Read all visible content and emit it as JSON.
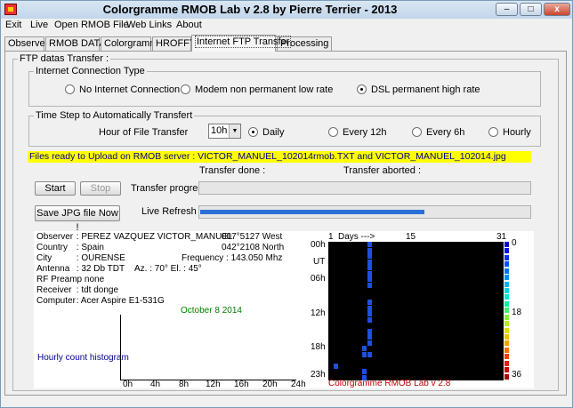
{
  "window": {
    "title": "Colorgramme RMOB Lab v 2.8  by Pierre Terrier  -  2013",
    "min_glyph": "–",
    "max_glyph": "□",
    "close_glyph": "x"
  },
  "menu": [
    "Exit",
    "Live",
    "Open RMOB File",
    "Web Links",
    "About"
  ],
  "tabs": [
    "Observer",
    "RMOB DATA",
    "Colorgramme",
    "HROFFT",
    "Internet FTP Transfer",
    "Processing"
  ],
  "active_tab": "Internet FTP Transfer",
  "ftp_group_label": "FTP datas Transfer :",
  "connection": {
    "label": "Internet Connection Type",
    "options": [
      "No Internet Connection",
      "Modem non permanent low rate",
      "DSL permanent high rate"
    ],
    "selected": "DSL permanent high rate"
  },
  "timestep": {
    "label": "Time Step to Automatically Transfert",
    "hour_label": "Hour of File Transfer",
    "hour_value": "10h",
    "options": [
      "Daily",
      "Every 12h",
      "Every 6h",
      "Hourly"
    ],
    "selected": "Daily"
  },
  "ready_text": "Files ready to Upload on RMOB server : VICTOR_MANUEL_102014rmob.TXT and VICTOR_MANUEL_102014.jpg",
  "transfer_done_label": "Transfer done :",
  "transfer_aborted_label": "Transfer aborted :",
  "start_label": "Start",
  "stop_label": "Stop",
  "transfer_progress_label": "Transfer progress",
  "transfer_progress": 0,
  "save_label": "Save  JPG  file Now !",
  "live_refresh_label": "Live Refresh",
  "live_refresh_progress": 0.68,
  "observer": {
    "observer": "PEREZ VAZQUEZ VICTOR_MANUEL",
    "longitude": "007°5127 West",
    "latitude": "042°2108 North",
    "country": "Spain",
    "city": "OURENSE",
    "frequency": "Frequency : 143.050 Mhz",
    "antenna": "32 Db TDT",
    "az_el": "Az. : 70°  El. : 45°",
    "rf_preamp": "none",
    "receiver": "tdt donge",
    "computer": "Acer Aspire E1-531G",
    "labels": {
      "observer": "Observer",
      "country": "Country",
      "city": "City",
      "antenna": "Antenna",
      "rf_preamp": "RF Preamp",
      "receiver": "Receiver",
      "computer": "Computer"
    }
  },
  "histogram": {
    "date": "October 8 2014",
    "label": "Hourly count histogram",
    "x_ticks": [
      "0h",
      "4h",
      "8h",
      "12h",
      "16h",
      "20h",
      "24h"
    ]
  },
  "colorgramme": {
    "x_start": "1",
    "days_label": "Days --->",
    "x_mid": "15",
    "x_end": "31",
    "y_labels": [
      "00h",
      "UT",
      "06h",
      "12h",
      "18h",
      "23h"
    ],
    "scale_labels": [
      "0",
      "18",
      "36"
    ],
    "footer": "Colorgramme RMOB Lab v 2.8",
    "cells": [
      {
        "day": 7,
        "hour": 0,
        "color": "#1f4fe0"
      },
      {
        "day": 7,
        "hour": 1,
        "color": "#1f4fe0"
      },
      {
        "day": 7,
        "hour": 2,
        "color": "#1f4fe0"
      },
      {
        "day": 7,
        "hour": 3,
        "color": "#1f4fe0"
      },
      {
        "day": 7,
        "hour": 4,
        "color": "#1f4fe0"
      },
      {
        "day": 7,
        "hour": 5,
        "color": "#1f4fe0"
      },
      {
        "day": 7,
        "hour": 6,
        "color": "#1f4fe0"
      },
      {
        "day": 7,
        "hour": 7,
        "color": "#1f4fe0"
      },
      {
        "day": 7,
        "hour": 10,
        "color": "#1f4fe0"
      },
      {
        "day": 7,
        "hour": 11,
        "color": "#1f4fe0"
      },
      {
        "day": 7,
        "hour": 12,
        "color": "#1f4fe0"
      },
      {
        "day": 7,
        "hour": 13,
        "color": "#1f4fe0"
      },
      {
        "day": 7,
        "hour": 15,
        "color": "#1f4fe0"
      },
      {
        "day": 7,
        "hour": 16,
        "color": "#1f4fe0"
      },
      {
        "day": 7,
        "hour": 17,
        "color": "#1f4fe0"
      },
      {
        "day": 6,
        "hour": 18,
        "color": "#1f4fe0"
      },
      {
        "day": 6,
        "hour": 19,
        "color": "#1f4fe0"
      },
      {
        "day": 7,
        "hour": 19,
        "color": "#1f4fe0"
      },
      {
        "day": 1,
        "hour": 21,
        "color": "#1f4fe0"
      },
      {
        "day": 6,
        "hour": 22,
        "color": "#1f4fe0"
      },
      {
        "day": 6,
        "hour": 23,
        "color": "#1f4fe0"
      }
    ],
    "scale_colors": [
      "#0000c8",
      "#0010e0",
      "#0030f0",
      "#0050f8",
      "#0070ff",
      "#0090ff",
      "#00b0ff",
      "#00d0f0",
      "#00e8d0",
      "#00f0a0",
      "#40f070",
      "#80f040",
      "#b0f020",
      "#d8e000",
      "#f0c000",
      "#f8a000",
      "#f87000",
      "#f04000",
      "#e02000",
      "#c80000",
      "#b00000"
    ]
  }
}
